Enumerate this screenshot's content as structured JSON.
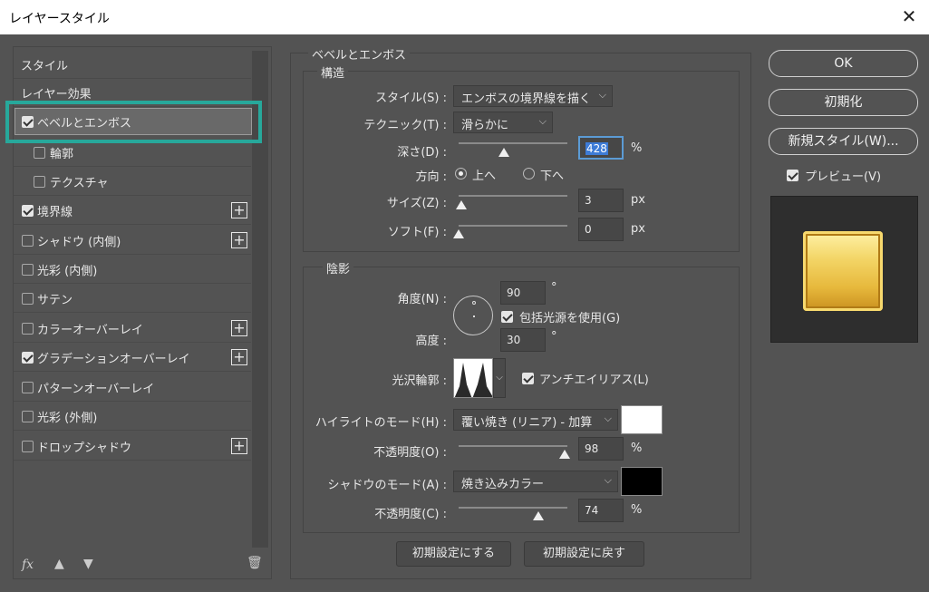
{
  "window": {
    "title": "レイヤースタイル",
    "close": "✕"
  },
  "styles_list": {
    "header_styles": "スタイル",
    "header_effects": "レイヤー効果",
    "items": [
      {
        "label": "ベベルとエンボス",
        "checked": true
      },
      {
        "label": "輪郭",
        "checked": false
      },
      {
        "label": "テクスチャ",
        "checked": false
      },
      {
        "label": "境界線",
        "checked": true
      },
      {
        "label": "シャドウ (内側)",
        "checked": false
      },
      {
        "label": "光彩 (内側)",
        "checked": false
      },
      {
        "label": "サテン",
        "checked": false
      },
      {
        "label": "カラーオーバーレイ",
        "checked": false
      },
      {
        "label": "グラデーションオーバーレイ",
        "checked": true
      },
      {
        "label": "パターンオーバーレイ",
        "checked": false
      },
      {
        "label": "光彩 (外側)",
        "checked": false
      },
      {
        "label": "ドロップシャドウ",
        "checked": false
      }
    ],
    "fx": "fx"
  },
  "bevel": {
    "section_title": "ベベルとエンボス",
    "structure_title": "構造",
    "style_label": "スタイル(S) :",
    "style_value": "エンボスの境界線を描く",
    "technique_label": "テクニック(T) :",
    "technique_value": "滑らかに",
    "depth_label": "深さ(D) :",
    "depth_value": "428",
    "direction_label": "方向 :",
    "dir_up": "上へ",
    "dir_down": "下へ",
    "size_label": "サイズ(Z) :",
    "size_value": "3",
    "soften_label": "ソフト(F) :",
    "soften_value": "0",
    "unit_pct": "%",
    "unit_px": "px"
  },
  "shading": {
    "title": "陰影",
    "angle_label": "角度(N) :",
    "angle_value": "90",
    "global_light": "包括光源を使用(G)",
    "altitude_label": "高度 :",
    "altitude_value": "30",
    "degree": "°",
    "gloss_label": "光沢輪郭 :",
    "anti_alias": "アンチエイリアス(L)",
    "highlight_label": "ハイライトのモード(H) :",
    "highlight_value": "覆い焼き (リニア) - 加算",
    "highlight_opacity_label": "不透明度(O) :",
    "highlight_opacity_value": "98",
    "shadow_label": "シャドウのモード(A) :",
    "shadow_value": "焼き込みカラー",
    "shadow_opacity_label": "不透明度(C) :",
    "shadow_opacity_value": "74",
    "highlight_color": "#ffffff",
    "shadow_color": "#000000"
  },
  "buttons": {
    "make_default": "初期設定にする",
    "reset_default": "初期設定に戻す",
    "ok": "OK",
    "reset": "初期化",
    "new_style": "新規スタイル(W)...",
    "preview": "プレビュー(V)"
  },
  "accent": "#27a89b"
}
